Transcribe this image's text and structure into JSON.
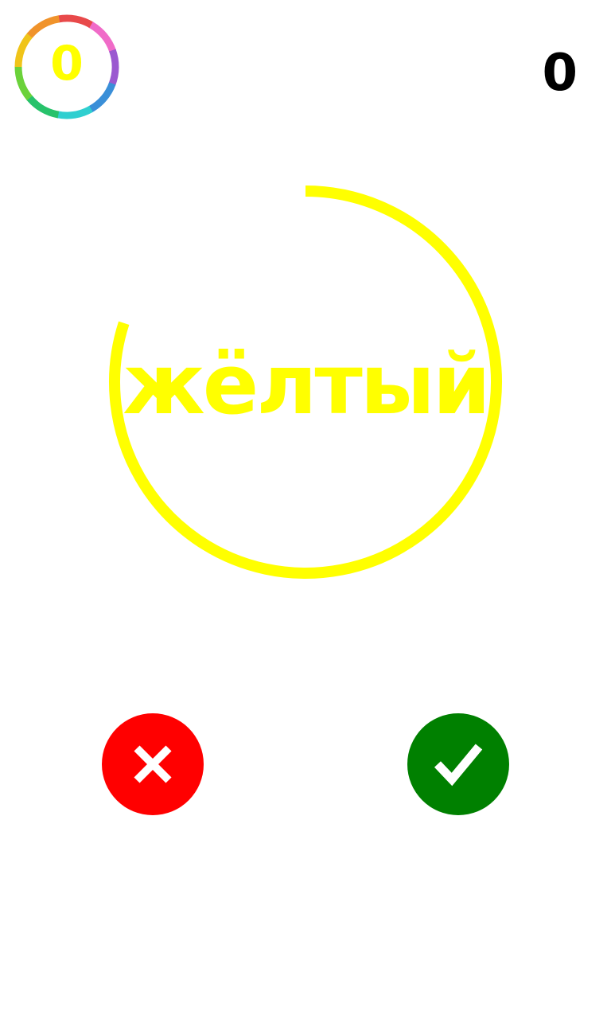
{
  "hud": {
    "best_score": "0",
    "score": "0",
    "best_ring_colors": [
      "#e8494a",
      "#f06bc8",
      "#9b59d0",
      "#3a8fd8",
      "#2fcfd0",
      "#27c26b",
      "#6bd23a",
      "#f0c419",
      "#f0932b"
    ]
  },
  "game": {
    "word": "жёлтый",
    "word_color": "#ffff00",
    "timer_color": "#ffff00",
    "timer_remaining_fraction": 0.8
  },
  "buttons": {
    "no": {
      "color": "#ff0000",
      "icon": "cross-icon"
    },
    "yes": {
      "color": "#008000",
      "icon": "check-icon"
    }
  }
}
